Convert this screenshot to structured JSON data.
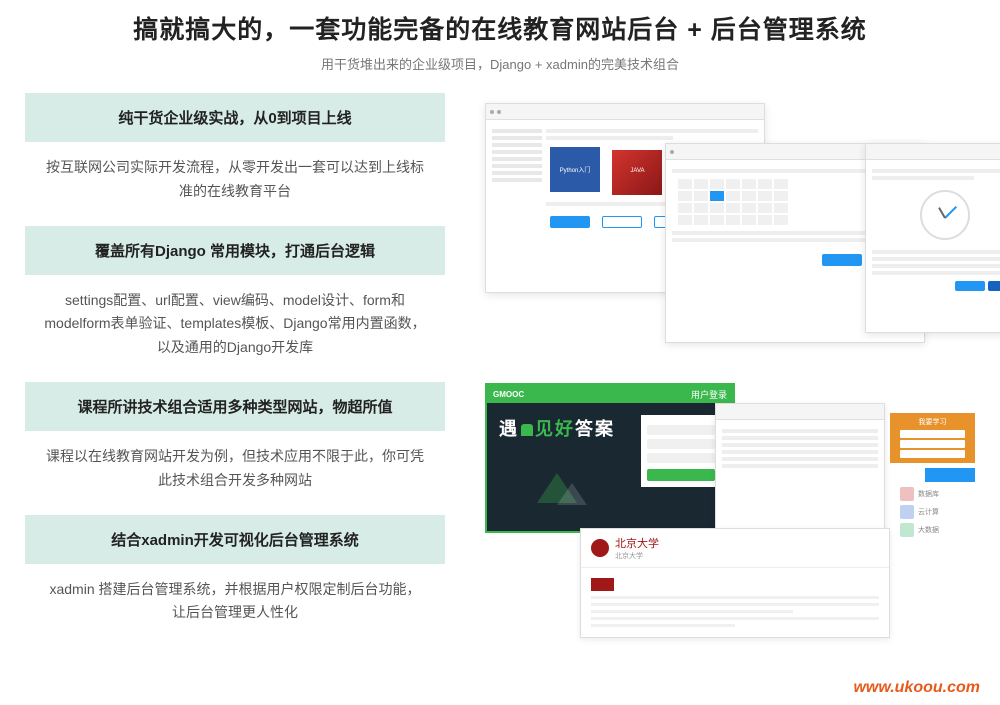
{
  "header": {
    "title": "搞就搞大的，一套功能完备的在线教育网站后台 + 后台管理系统",
    "subtitle": "用干货堆出来的企业级项目，Django + xadmin的完美技术组合"
  },
  "sections": [
    {
      "title": "纯干货企业级实战，从0到项目上线",
      "desc": "按互联网公司实际开发流程，从零开发出一套可以达到上线标准的在线教育平台"
    },
    {
      "title": "覆盖所有Django 常用模块，打通后台逻辑",
      "desc": "settings配置、url配置、view编码、model设计、form和 modelform表单验证、templates模板、Django常用内置函数，以及通用的Django开发库"
    },
    {
      "title": "课程所讲技术组合适用多种类型网站，物超所值",
      "desc": "课程以在线教育网站开发为例，但技术应用不限于此，你可凭此技术组合开发多种网站"
    },
    {
      "title": "结合xadmin开发可视化后台管理系统",
      "desc": "xadmin 搭建后台管理系统，并根据用户权限定制后台功能，让后台管理更人性化"
    }
  ],
  "mockups": {
    "card1": "Python入门",
    "card2": "JAVA",
    "login_panel_title": "用户登录",
    "logo": "GMOOC",
    "dark_text_pre": "遇",
    "dark_text_mid": "见好",
    "dark_text_post": "答案",
    "uni_name": "北京大学",
    "uni_sub": "北京大学",
    "orange_title": "我要学习",
    "list1": "数据库",
    "list2": "云计算",
    "list3": "大数据"
  },
  "watermark": "www.ukoou.com"
}
